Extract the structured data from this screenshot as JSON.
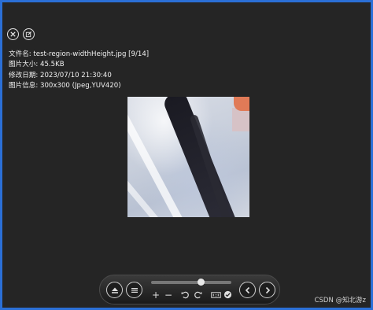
{
  "icons": {
    "close": "close-icon",
    "edit": "edit-icon"
  },
  "info": {
    "filename_line": "文件名: test-region-widthHeight.jpg [9/14]",
    "size_line": "图片大小: 45.5KB",
    "date_line": "修改日期: 2023/07/10 21:30:40",
    "meta_line": "图片信息: 300x300 (Jpeg,YUV420)"
  },
  "viewer": {
    "zoom_slider_level": 0.62,
    "zoom_in_label": "+",
    "zoom_out_label": "−"
  },
  "watermark": "CSDN @知北游z",
  "colors": {
    "window_border": "#2b6fd6",
    "background": "#252525",
    "text": "#f0f0f0"
  }
}
